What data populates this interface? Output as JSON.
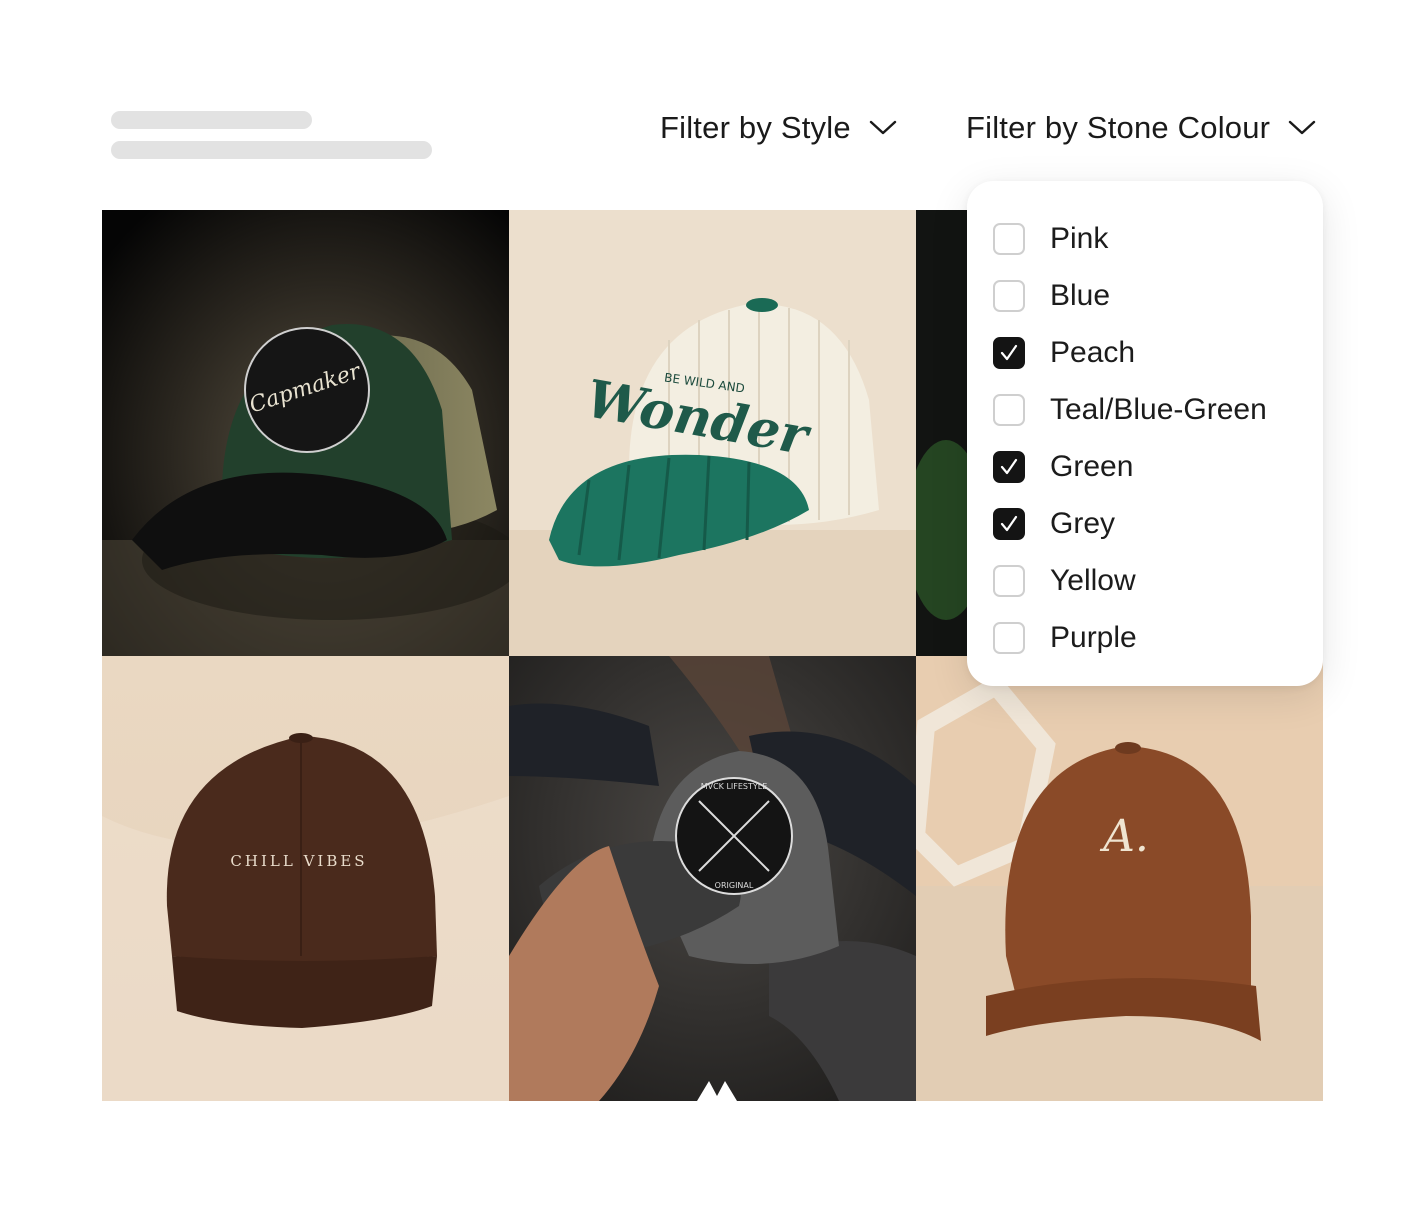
{
  "filters": {
    "style_label": "Filter by Style",
    "colour_label": "Filter by Stone Colour"
  },
  "colour_options": [
    {
      "label": "Pink",
      "checked": false
    },
    {
      "label": "Blue",
      "checked": false
    },
    {
      "label": "Peach",
      "checked": true
    },
    {
      "label": "Teal/Blue-Green",
      "checked": false
    },
    {
      "label": "Green",
      "checked": true
    },
    {
      "label": "Grey",
      "checked": true
    },
    {
      "label": "Yellow",
      "checked": false
    },
    {
      "label": "Purple",
      "checked": false
    }
  ],
  "products": [
    {
      "name": "green-trucker-cap",
      "logo_text": "Capmaker"
    },
    {
      "name": "corduroy-wonder-cap",
      "logo_text": "Wonder",
      "logo_subtext": "BE WILD AND"
    },
    {
      "name": "cap-3",
      "logo_text": ""
    },
    {
      "name": "brown-chill-vibes-cap",
      "logo_text": "CHILL VIBES"
    },
    {
      "name": "grey-patch-cap",
      "logo_text": "MVCK LIFESTYLE",
      "logo_subtext": "ORIGINAL"
    },
    {
      "name": "brown-a-cap",
      "logo_text": "A."
    }
  ],
  "colors": {
    "text": "#1a1a1a",
    "checkbox_checked": "#141414",
    "checkbox_border": "#cfcfcf",
    "skeleton": "#e2e2e2"
  }
}
